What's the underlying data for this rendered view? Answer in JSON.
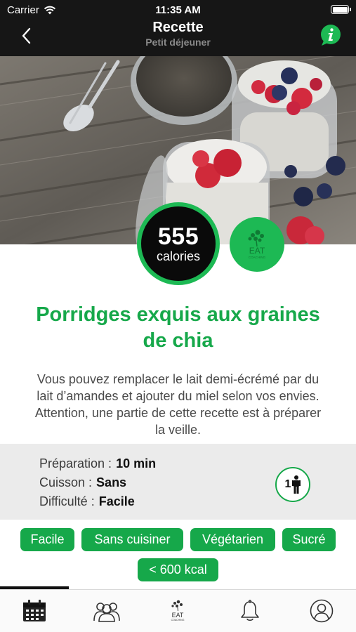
{
  "status_bar": {
    "carrier": "Carrier",
    "time": "11:35 AM"
  },
  "nav": {
    "title": "Recette",
    "subtitle": "Petit déjeuner"
  },
  "badge": {
    "calories": "555",
    "calories_unit": "calories"
  },
  "logo": {
    "brand": "EAT",
    "tagline": "COACHING"
  },
  "recipe": {
    "title_line1": "Porridges exquis aux graines",
    "title_line2": "de chia",
    "desc_line1": "Vous pouvez remplacer le lait demi-écrémé par du",
    "desc_line2": "lait d’amandes et ajouter du miel selon vos envies.",
    "desc_line3": "Attention, une partie de cette recette est à préparer",
    "desc_line4": "la veille."
  },
  "details": {
    "prep_label": "Préparation :",
    "prep_value": "10 min",
    "cook_label": "Cuisson :",
    "cook_value": "Sans",
    "difficulty_label": "Difficulté :",
    "difficulty_value": "Facile",
    "persons": "1"
  },
  "tags": [
    "Facile",
    "Sans cuisiner",
    "Végétarien",
    "Sucré",
    "< 600 kcal"
  ],
  "tabbar": {
    "icons": [
      "calendar-icon",
      "community-icon",
      "eat-logo-icon",
      "bell-icon",
      "profile-icon"
    ]
  },
  "colors": {
    "accent": "#16a84a",
    "dark": "#161616",
    "details_bg": "#ebebeb"
  }
}
